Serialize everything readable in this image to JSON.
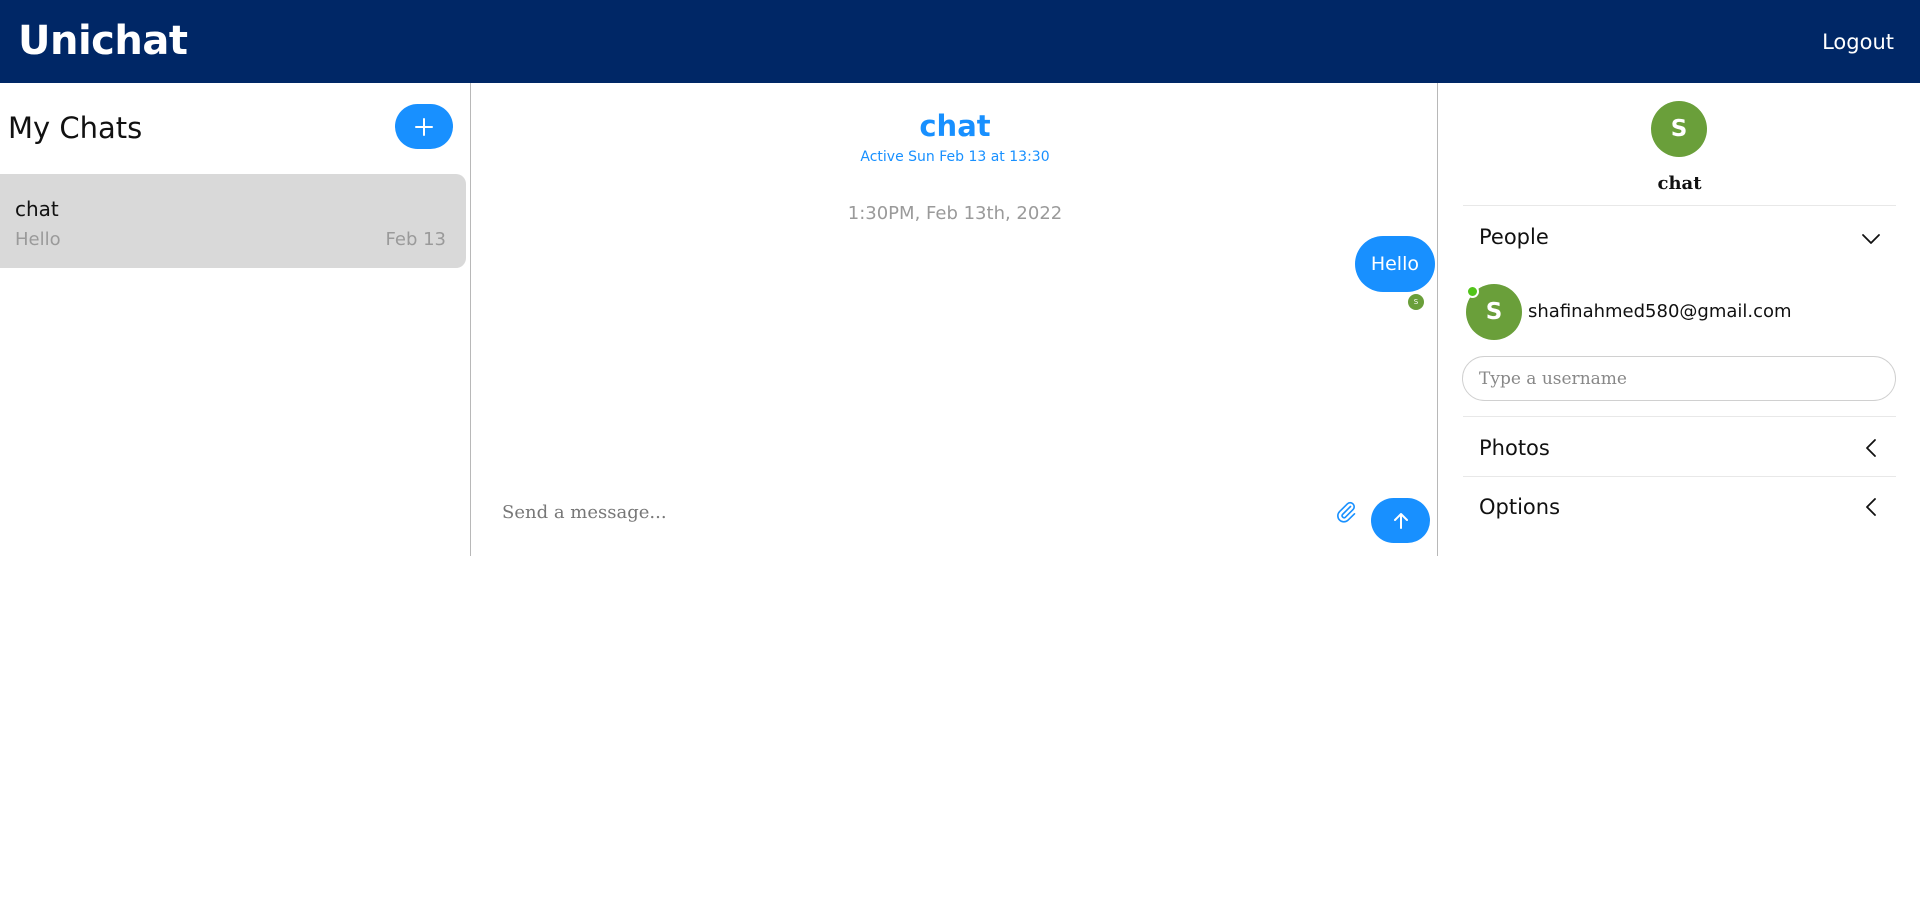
{
  "header": {
    "brand": "Unichat",
    "logout_label": "Logout",
    "bg_color": "#002766"
  },
  "chat_list": {
    "title": "My Chats",
    "new_chat_icon": "plus-icon",
    "items": [
      {
        "title": "chat",
        "last_message": "Hello",
        "date": "Feb 13"
      }
    ]
  },
  "feed": {
    "title": "chat",
    "subtitle": "Active Sun Feb 13 at 13:30",
    "timestamp": "1:30PM, Feb 13th, 2022",
    "messages": [
      {
        "text": "Hello",
        "mine": true,
        "read_by_initial": "S"
      }
    ],
    "input_placeholder": "Send a message...",
    "attach_icon": "paperclip-icon",
    "send_icon": "arrow-up-icon"
  },
  "settings": {
    "avatar_initial": "S",
    "chat_name": "chat",
    "people_title": "People",
    "people": [
      {
        "initial": "S",
        "email": "shafinahmed580@gmail.com",
        "online": true
      }
    ],
    "username_placeholder": "Type a username",
    "photos_title": "Photos",
    "options_title": "Options"
  },
  "colors": {
    "accent": "#1890ff",
    "avatar": "#6a9f3a",
    "online": "#52c41a",
    "selected_card": "#d9d9d9"
  }
}
